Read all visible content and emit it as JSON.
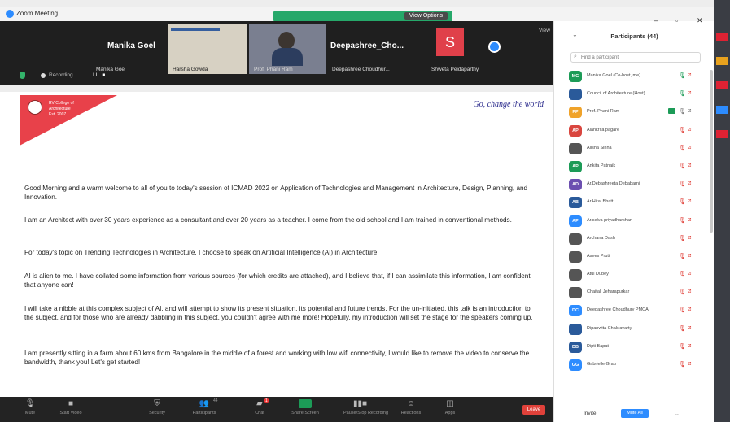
{
  "window": {
    "title": "Zoom Meeting"
  },
  "top": {
    "view_options": "View Options",
    "view": "View"
  },
  "videos": [
    {
      "big_name": "Manika Goel",
      "name": "Manika Goel"
    },
    {
      "name": "Harsha Gowda"
    },
    {
      "name": "Prof. Phani Ram"
    },
    {
      "big_name": "Deepashree_Cho...",
      "name": "Deepashree Choudhur..."
    },
    {
      "initial": "S",
      "name": "Shweta Peidaparthy"
    }
  ],
  "recording": {
    "label": "Recording...",
    "controls": "II  ■"
  },
  "slide": {
    "college_line1": "RV College of",
    "college_line2": "Architecture",
    "college_line3": "Est. 2007",
    "tagline": "Go, change the world",
    "paragraphs": [
      "Good Morning and a warm welcome to all of you to today's session of ICMAD 2022 on Application of Technologies and Management in Architecture, Design, Planning, and Innovation.",
      "I am an Architect with over 30 years experience as a consultant and over 20 years as a teacher. I come from the old school and I am trained in conventional methods.",
      "For today's topic on Trending Technologies in Architecture, I choose to speak on Artificial Intelligence (AI) in Architecture.",
      "AI is alien to me. I have collated some information from various sources (for which credits are attached), and I believe that, if I can assimilate this information, I am confident that anyone can!",
      "I will take a nibble at this complex subject of AI, and will attempt to show its present situation, its potential and future trends. For the un-initiated, this talk is an introduction to the subject, and for those who are already dabbling in this subject, you couldn't agree with me more! Hopefully, my introduction will set the stage for the speakers coming up.",
      "I am presently sitting in a farm about 60 kms from Bangalore in the middle of a forest and working with low wifi connectivity, I would like to remove the video to conserve the bandwidth, thank you! Let's get started!"
    ]
  },
  "toolbar": {
    "mute": "Mute",
    "start_video": "Start Video",
    "security": "Security",
    "participants": "Participants",
    "participants_count": "44",
    "chat": "Chat",
    "chat_badge": "1",
    "share_screen": "Share Screen",
    "pause_recording": "Pause/Stop Recording",
    "reactions": "Reactions",
    "apps": "Apps",
    "leave": "Leave"
  },
  "participants_panel": {
    "title": "Participants (44)",
    "search_placeholder": "Find a participant",
    "invite": "Invite",
    "mute_all": "Mute All",
    "items": [
      {
        "initials": "MG",
        "color": "#1c9b57",
        "name": "Manika Goel (Co-host, me)"
      },
      {
        "initials": "",
        "color": "#2a5a9a",
        "name": "Council of Architecture (Host)"
      },
      {
        "initials": "PP",
        "color": "#f0a32a",
        "name": "Prof. Phani Ram"
      },
      {
        "initials": "AP",
        "color": "#d9463f",
        "name": "Alankrita pagare"
      },
      {
        "initials": "",
        "color": "#555555",
        "name": "Alisha Sinha"
      },
      {
        "initials": "AP",
        "color": "#1c9b57",
        "name": "Ankita Patnaik"
      },
      {
        "initials": "AD",
        "color": "#6c4fb0",
        "name": "Ar.Debashreeta Debabarni"
      },
      {
        "initials": "AB",
        "color": "#2a5a9a",
        "name": "Ar.Hiral Bhatt"
      },
      {
        "initials": "AP",
        "color": "#2d8cff",
        "name": "Ar.selva priyadharshan"
      },
      {
        "initials": "",
        "color": "#555555",
        "name": "Archana Dash"
      },
      {
        "initials": "",
        "color": "#555555",
        "name": "Asees Pruti"
      },
      {
        "initials": "",
        "color": "#555555",
        "name": "Atul Dubey"
      },
      {
        "initials": "",
        "color": "#555555",
        "name": "Chaitali Jeharapurkar"
      },
      {
        "initials": "DC",
        "color": "#2d8cff",
        "name": "Deepashree Choudhury PMCA"
      },
      {
        "initials": "",
        "color": "#2a5a9a",
        "name": "Dipanwita Chakravarty"
      },
      {
        "initials": "DB",
        "color": "#2a5a9a",
        "name": "Dipti Bapat"
      },
      {
        "initials": "GG",
        "color": "#2d8cff",
        "name": "Gabrielle Grau"
      }
    ]
  }
}
